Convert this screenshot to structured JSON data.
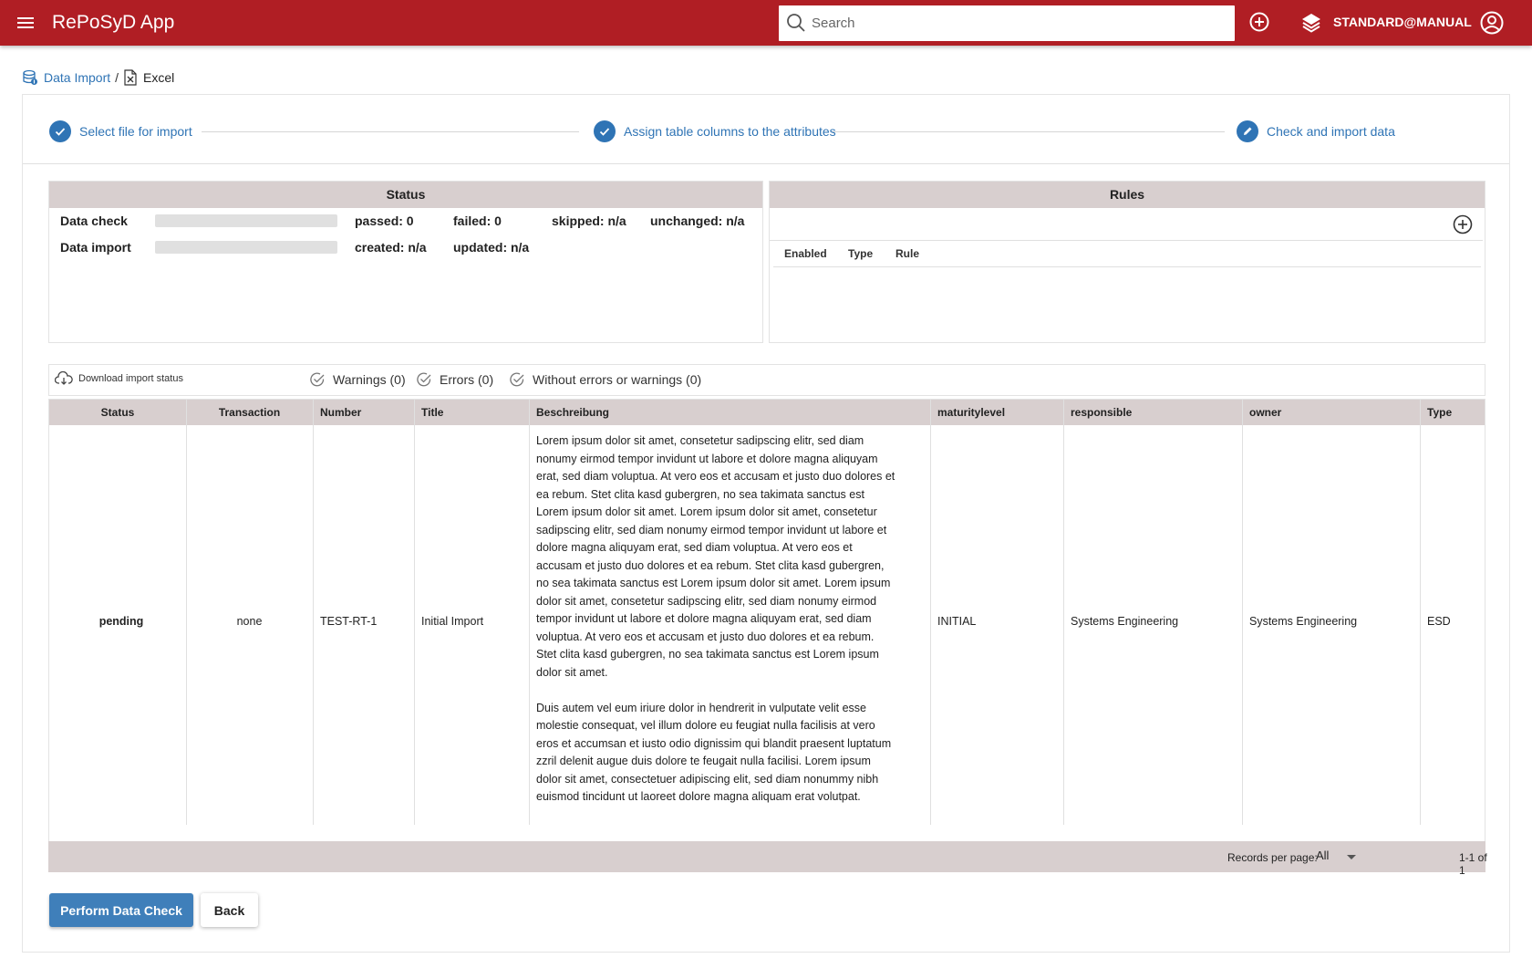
{
  "app": {
    "title": "RePoSyD App"
  },
  "search": {
    "placeholder": "Search"
  },
  "user": {
    "label": "STANDARD@MANUAL"
  },
  "breadcrumb": {
    "link": "Data Import",
    "separator": "/",
    "current": "Excel"
  },
  "steps": [
    {
      "label": "Select file for import",
      "state": "done"
    },
    {
      "label": "Assign table columns to the attributes",
      "state": "done"
    },
    {
      "label": "Check and import data",
      "state": "active"
    }
  ],
  "status_panel": {
    "title": "Status",
    "rows": [
      {
        "label": "Data check",
        "progress": 0,
        "stats": [
          "passed: 0",
          "failed: 0",
          "skipped: n/a",
          "unchanged: n/a"
        ]
      },
      {
        "label": "Data import",
        "progress": 0,
        "stats": [
          "created: n/a",
          "updated: n/a"
        ]
      }
    ]
  },
  "rules_panel": {
    "title": "Rules",
    "columns": [
      "Enabled",
      "Type",
      "Rule"
    ]
  },
  "toolbar": {
    "download": "Download import status",
    "filters": [
      "Warnings (0)",
      "Errors (0)",
      "Without errors or warnings (0)"
    ]
  },
  "table": {
    "columns": [
      "Status",
      "Transaction",
      "Number",
      "Title",
      "Beschreibung",
      "maturitylevel",
      "responsible",
      "owner",
      "Type"
    ],
    "rows": [
      {
        "status": "pending",
        "transaction": "none",
        "number": "TEST-RT-1",
        "title": "Initial Import",
        "description_p1": "Lorem ipsum dolor sit amet, consetetur sadipscing elitr, sed diam nonumy eirmod tempor invidunt ut labore et dolore magna aliquyam erat, sed diam voluptua. At vero eos et accusam et justo duo dolores et ea rebum. Stet clita kasd gubergren, no sea takimata sanctus est Lorem ipsum dolor sit amet. Lorem ipsum dolor sit amet, consetetur sadipscing elitr, sed diam nonumy eirmod tempor invidunt ut labore et dolore magna aliquyam erat, sed diam voluptua. At vero eos et accusam et justo duo dolores et ea rebum. Stet clita kasd gubergren, no sea takimata sanctus est Lorem ipsum dolor sit amet. Lorem ipsum dolor sit amet, consetetur sadipscing elitr, sed diam nonumy eirmod tempor invidunt ut labore et dolore magna aliquyam erat, sed diam voluptua. At vero eos et accusam et justo duo dolores et ea rebum. Stet clita kasd gubergren, no sea takimata sanctus est Lorem ipsum dolor sit amet.",
        "description_p2": "Duis autem vel eum iriure dolor in hendrerit in vulputate velit esse molestie consequat, vel illum dolore eu feugiat nulla facilisis at vero eros et accumsan et iusto odio dignissim qui blandit praesent luptatum zzril delenit augue duis dolore te feugait nulla facilisi. Lorem ipsum dolor sit amet, consectetuer adipiscing elit, sed diam nonummy nibh euismod tincidunt ut laoreet dolore magna aliquam erat volutpat.",
        "maturitylevel": "INITIAL",
        "responsible": "Systems Engineering",
        "owner": "Systems Engineering",
        "type": "ESD"
      }
    ],
    "footer": {
      "rpp_label": "Records per page:",
      "rpp_value": "All",
      "range": "1-1 of 1"
    }
  },
  "actions": {
    "check": "Perform Data Check",
    "back": "Back"
  },
  "colors": {
    "appbar": "#b01e24",
    "accent": "#2f74b5",
    "header_bg": "#d8cfcf",
    "button": "#3f7fba"
  }
}
